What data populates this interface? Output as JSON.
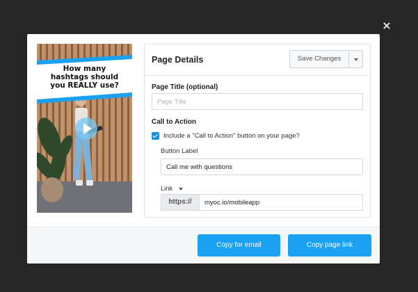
{
  "close_label": "×",
  "thumbnail": {
    "title_lines": [
      "How many",
      "hashtags should",
      "you REALLY use?"
    ]
  },
  "details": {
    "title": "Page Details",
    "save_label": "Save Changes",
    "page_title_label": "Page Title (optional)",
    "page_title_placeholder": "Page Title",
    "page_title_value": "",
    "cta_heading": "Call to Action",
    "cta_checkbox_label": "Include a \"Call to Action\" button on your page?",
    "cta_checked": true,
    "button_label_heading": "Button Label",
    "button_label_value": "Call me with questions",
    "link_heading": "Link",
    "link_prefix": "https://",
    "link_value": "myoc.io/mobileapp"
  },
  "footer": {
    "copy_email_label": "Copy for email",
    "copy_link_label": "Copy page link"
  },
  "colors": {
    "backdrop": "#262626",
    "accent": "#1ba1f2",
    "checkbox": "#1a8fd8",
    "banner": "#1ba1f2"
  }
}
